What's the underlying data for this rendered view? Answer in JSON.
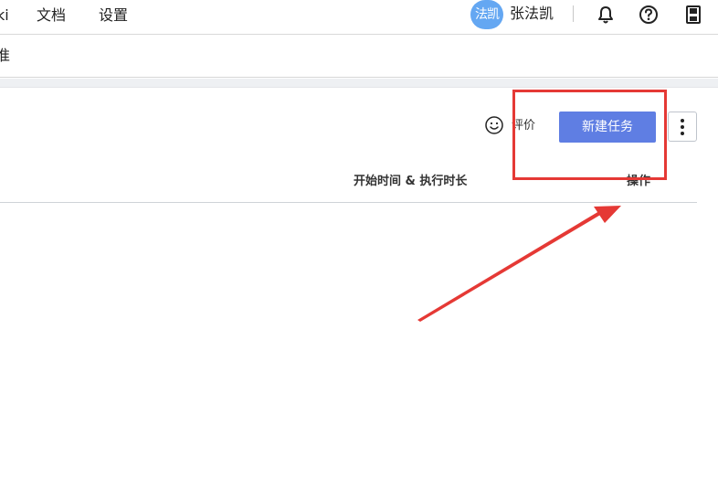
{
  "topnav": {
    "items": [
      {
        "label": "ki"
      },
      {
        "label": "文档"
      },
      {
        "label": "设置"
      }
    ],
    "avatar_text": "法凯",
    "username": "张法凯",
    "icons": [
      "bell-icon",
      "help-icon",
      "save-icon"
    ]
  },
  "subheader": {
    "title": "准"
  },
  "toolbar": {
    "rate_label": "评价",
    "new_task_label": "新建任务",
    "more_icon": "vertical-ellipsis-icon"
  },
  "table": {
    "columns": [
      "开始时间 & 执行时长",
      "操作"
    ]
  },
  "annotations": {
    "highlight_color": "#e53935",
    "arrow_color": "#e53935"
  },
  "colors": {
    "primary_button": "#5f7ee3",
    "avatar_bg": "#64a7f2"
  }
}
